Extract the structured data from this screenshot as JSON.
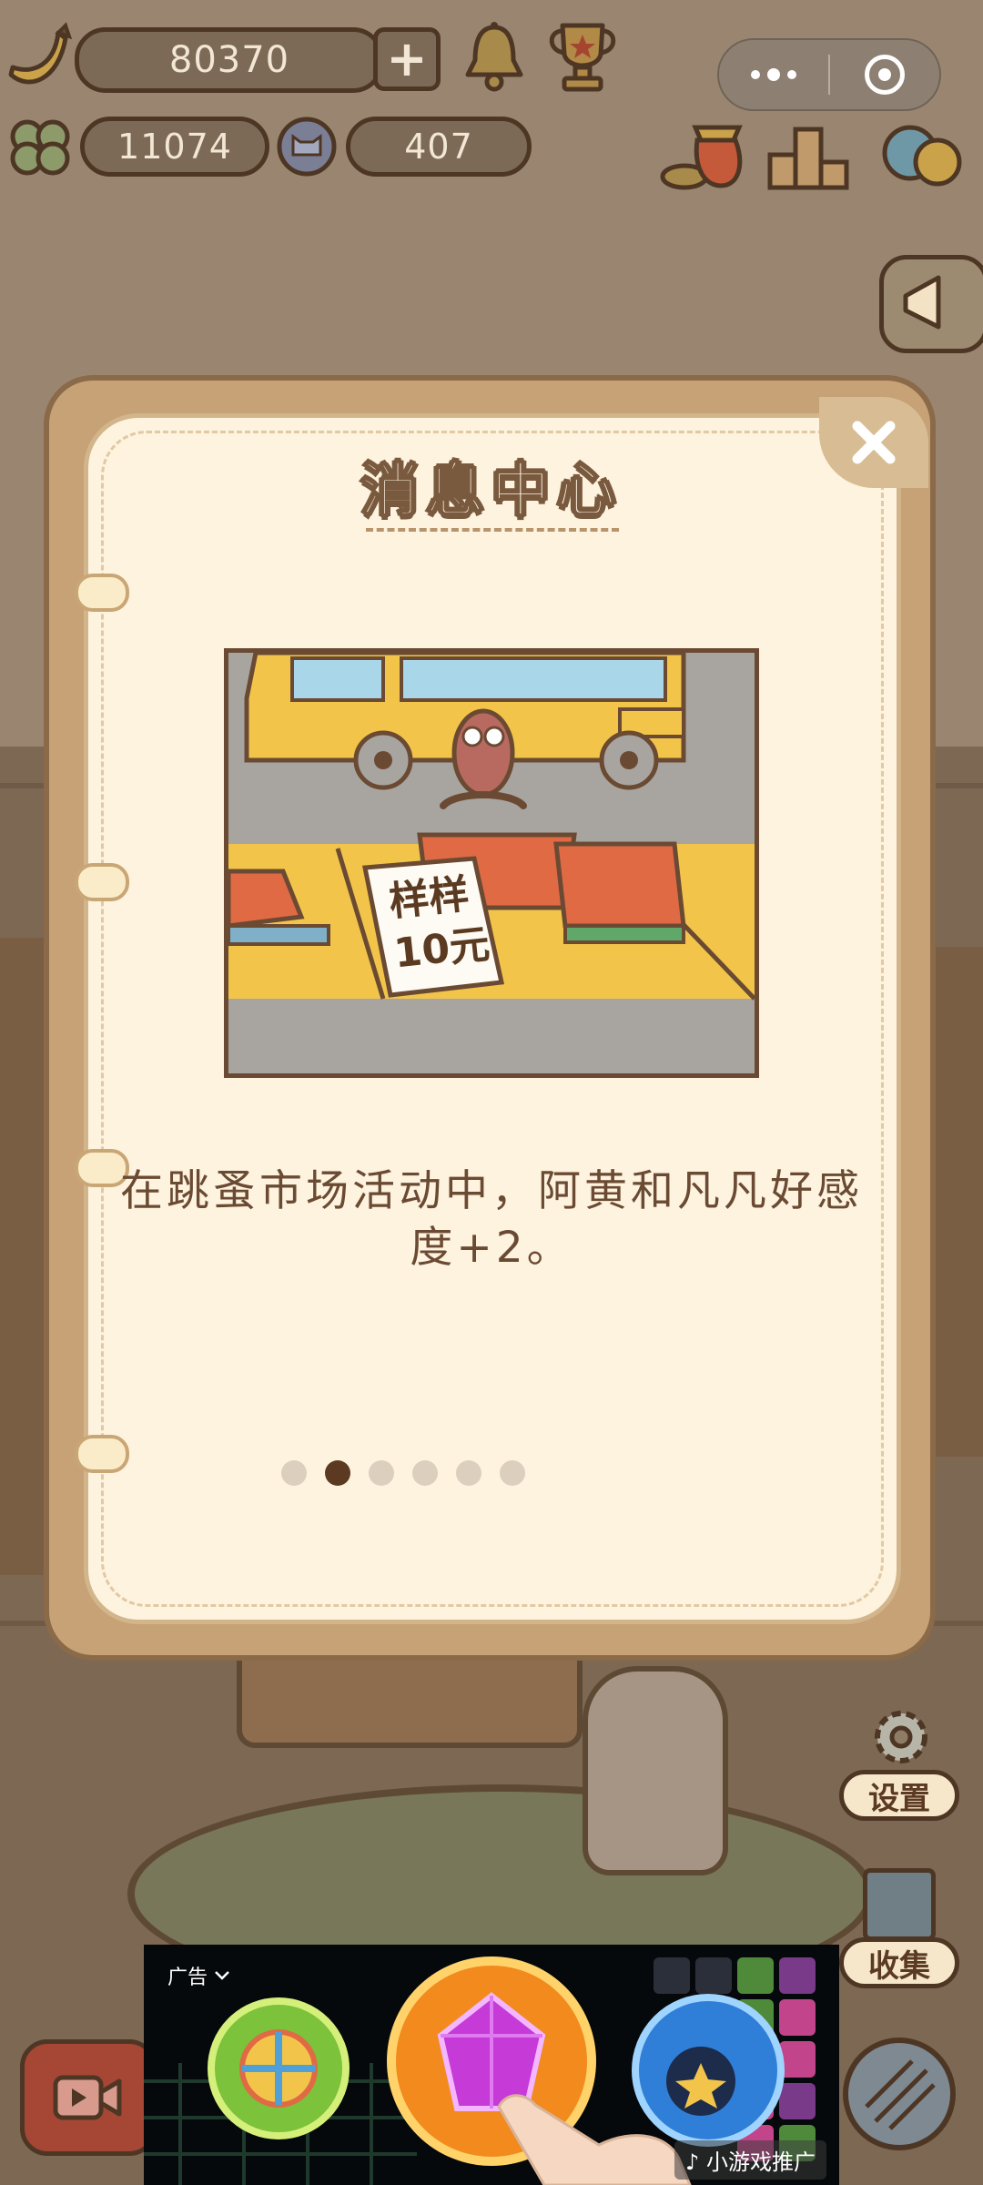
{
  "hud": {
    "banana_count": "80370",
    "plus_label": "+",
    "clover_count": "11074",
    "cat_coin_count": "407"
  },
  "dialog": {
    "title": "消息中心",
    "illustration_sign_line1": "样样",
    "illustration_sign_line2": "10元",
    "message": "在跳蚤市场活动中，阿黄和凡凡好感度+2。",
    "page_count": 6,
    "active_page": 2
  },
  "side_buttons": {
    "settings_label": "设置",
    "collection_label": "收集"
  },
  "ad": {
    "label": "广告",
    "promo_label": "小游戏推广"
  },
  "colors": {
    "dialog_frame": "#c6a276",
    "dialog_paper": "#fdf3df",
    "text_brown": "#6b4a33",
    "pager_active": "#5c3a22",
    "pager_inactive": "#dccfbe"
  }
}
